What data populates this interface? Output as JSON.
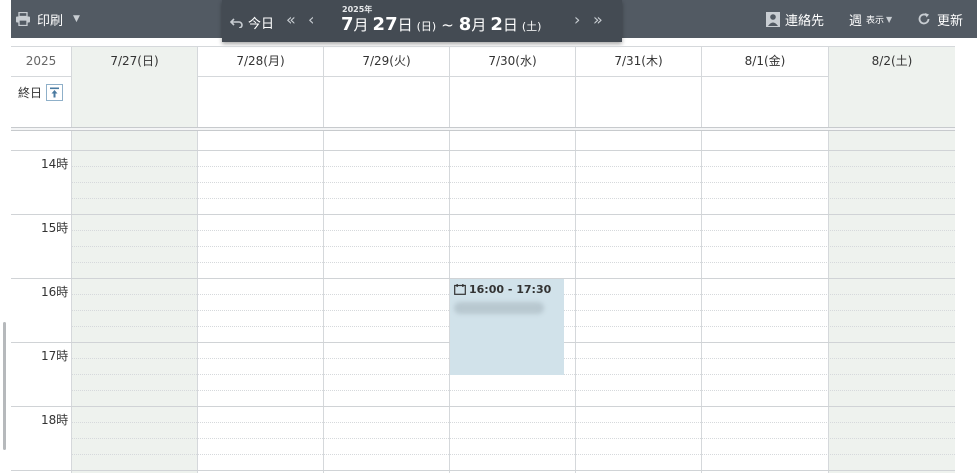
{
  "toolbar": {
    "print_label": "印刷",
    "today_label": "今日",
    "range_year": "2025年",
    "range": {
      "start_month": "7",
      "month_suffix": "月",
      "start_day": "27",
      "day_suffix": "日",
      "start_weekday": "(日)",
      "tilde": "~",
      "end_month": "8",
      "end_day": "2",
      "end_weekday": "(土)"
    },
    "contacts_label": "連絡先",
    "view_label": "週",
    "view_sub": "表示",
    "refresh_label": "更新"
  },
  "calendar": {
    "year": "2025",
    "days": [
      "7/27(日)",
      "7/28(月)",
      "7/29(火)",
      "7/30(水)",
      "7/31(木)",
      "8/1(金)",
      "8/2(土)"
    ],
    "weekend_days": [
      0,
      6
    ],
    "all_day_label": "終日",
    "hours": [
      "14時",
      "15時",
      "16時",
      "17時",
      "18時"
    ],
    "events": [
      {
        "day": "7/30(水)",
        "time": "16:00 - 17:30",
        "title_obscured": true
      }
    ]
  },
  "colors": {
    "topbar": "#525a63",
    "navbox": "#444b53",
    "weekend": "#eef2ee",
    "event": "#d1e2ea"
  },
  "icons": [
    "printer-icon",
    "undo-arrow-icon",
    "double-chevron-left-icon",
    "chevron-left-icon",
    "chevron-right-icon",
    "double-chevron-right-icon",
    "contact-icon",
    "refresh-icon",
    "calendar-clock-icon",
    "collapse-up-icon"
  ]
}
